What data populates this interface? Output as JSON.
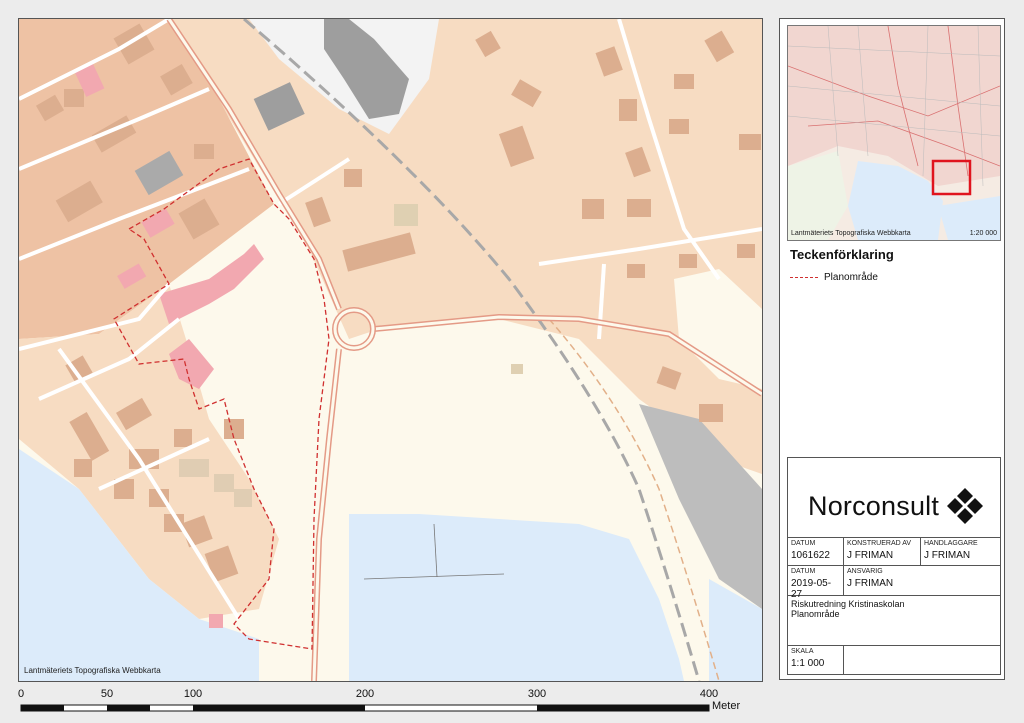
{
  "map": {
    "credit": "Lantmäteriets Topografiska Webbkarta",
    "colors": {
      "water": "#dcebfa",
      "land": "#fdf9ec",
      "residential": "#f7dcc2",
      "dense": "#eec2a4",
      "building": "#dcae8f",
      "road": "#e49a86",
      "railway": "#a8a8a8",
      "industrial": "#bdbdbd",
      "plan_boundary": "#d03030"
    }
  },
  "overview": {
    "credit": "Lantmäteriets Topografiska Webbkarta",
    "scale": "1:20 000"
  },
  "legend": {
    "title": "Teckenförklaring",
    "items": [
      {
        "label": "Planområde",
        "symbol": "red-dashed-line"
      }
    ]
  },
  "titleblock": {
    "company": "Norconsult",
    "datum_label": "DATUM",
    "datum_value": "1061622",
    "konstruerad_label": "KONSTRUERAD AV",
    "konstruerad_value": "J FRIMAN",
    "handlaggare_label": "HANDLAGGARE",
    "handlaggare_value": "J FRIMAN",
    "datum2_label": "DATUM",
    "datum2_value": "2019-05-27",
    "ansvarig_label": "ANSVARIG",
    "ansvarig_value": "J FRIMAN",
    "project_line1": "Riskutredning Kristinaskolan",
    "project_line2": "Planområde",
    "skala_label": "SKALA",
    "skala_value": "1:1 000"
  },
  "scalebar": {
    "ticks": [
      "0",
      "50",
      "100",
      "200",
      "300",
      "400"
    ],
    "unit": "Meter"
  }
}
